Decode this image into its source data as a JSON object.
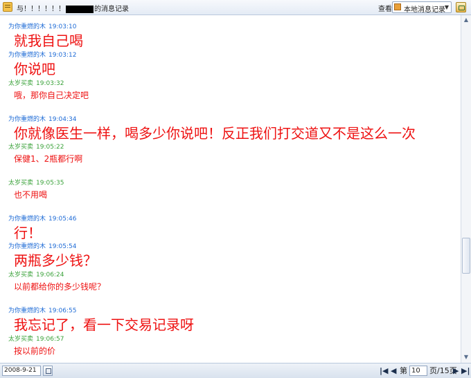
{
  "titlebar": {
    "title_prefix": "与",
    "title_masked": "！！！！！！",
    "title_suffix": "的消息记录",
    "view_label": "查看",
    "record_source": "本地消息记录"
  },
  "messages": [
    {
      "sender": "为你重燃的木",
      "time": "19:03:10",
      "text": "就我自己喝"
    },
    {
      "sender": "为你重燃的木",
      "time": "19:03:12",
      "text": "你说吧"
    },
    {
      "sender": "太岁买卖",
      "time": "19:03:32",
      "text": "哦，那你自己决定吧"
    },
    {
      "sender": "为你重燃的木",
      "time": "19:04:34",
      "text": "你就像医生一样，喝多少你说吧！反正我们打交道又不是这么一次"
    },
    {
      "sender": "太岁买卖",
      "time": "19:05:22",
      "text": "保健1、2瓶都行啊"
    },
    {
      "sender": "太岁买卖",
      "time": "19:05:35",
      "text": "也不用喝"
    },
    {
      "sender": "为你重燃的木",
      "time": "19:05:46",
      "text": "行！"
    },
    {
      "sender": "为你重燃的木",
      "time": "19:05:54",
      "text": "两瓶多少钱？"
    },
    {
      "sender": "太岁买卖",
      "time": "19:06:24",
      "text": "以前都给你的多少钱呢？"
    },
    {
      "sender": "为你重燃的木",
      "time": "19:06:55",
      "text": "我忘记了，看一下交易记录呀"
    },
    {
      "sender": "太岁买卖",
      "time": "19:06:57",
      "text": "按以前的价"
    }
  ],
  "footer": {
    "date": "2008-9-21",
    "page_prefix": "第",
    "page_current": "10",
    "page_suffix": "页/15页"
  },
  "colors": {
    "self_name": "#1e6bd6",
    "other_name": "#3aa23a",
    "message_text": "#ee1111"
  }
}
